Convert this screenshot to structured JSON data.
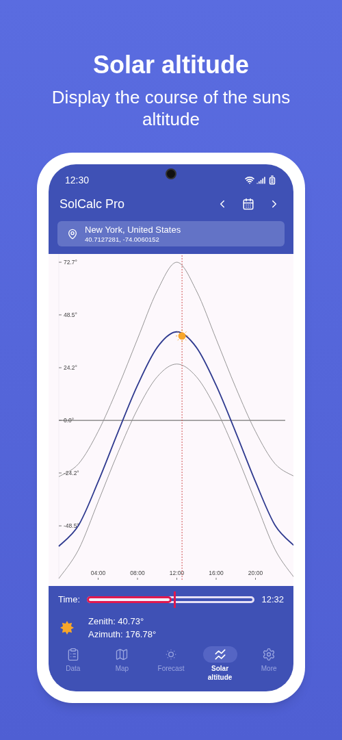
{
  "header": {
    "title": "Solar altitude",
    "subtitle": "Display the course of the suns altitude"
  },
  "status_bar": {
    "time": "12:30"
  },
  "app_bar": {
    "title": "SolCalc Pro"
  },
  "location": {
    "name": "New York, United States",
    "coordinates": "40.7127281, -74.0060152"
  },
  "chart": {
    "chart_data": {
      "type": "line",
      "x": [
        0,
        2,
        4,
        6,
        8,
        10,
        12,
        14,
        16,
        18,
        20,
        22,
        24
      ],
      "xlim": [
        0,
        24
      ],
      "ylim": [
        -73,
        76.5
      ],
      "xticks": [
        {
          "value": 4,
          "label": "04:00"
        },
        {
          "value": 8,
          "label": "08:00"
        },
        {
          "value": 12,
          "label": "12:00"
        },
        {
          "value": 16,
          "label": "16:00"
        },
        {
          "value": 20,
          "label": "20:00"
        }
      ],
      "yticks": [
        {
          "value": 72.7,
          "label": "72.7°"
        },
        {
          "value": 48.5,
          "label": "48.5°"
        },
        {
          "value": 24.2,
          "label": "24.2°"
        },
        {
          "value": 0,
          "label": "0.0°"
        },
        {
          "value": -24.2,
          "label": "-24.2°"
        },
        {
          "value": -48.5,
          "label": "-48.5°"
        }
      ],
      "series": [
        {
          "color": "#8a8a8a",
          "values": [
            -25.9,
            -20.0,
            -5.1,
            15.0,
            37.4,
            59.5,
            72.7,
            59.5,
            37.4,
            15.0,
            -5.1,
            -20.0,
            -25.9
          ]
        },
        {
          "color": "#8a8a8a",
          "values": [
            -72.7,
            -59.5,
            -37.4,
            -15.0,
            5.1,
            20.0,
            25.9,
            20.0,
            5.1,
            -15.0,
            -37.4,
            -59.5,
            -72.7
          ]
        },
        {
          "color": "#2f3a8f",
          "values": [
            -57.9,
            -48.3,
            -28.2,
            -5.6,
            16.1,
            33.5,
            40.7,
            33.5,
            16.1,
            -5.6,
            -28.2,
            -48.3,
            -57.9
          ]
        }
      ],
      "ref_lines": [
        {
          "axis": "x",
          "value": 12.53
        }
      ]
    }
  },
  "time_slider": {
    "label": "Time:",
    "level": 0.522,
    "value": "12:32"
  },
  "sun_info": {
    "zenith": "Zenith: 40.73°",
    "azimuth": "Azimuth: 176.78°"
  },
  "nav": [
    {
      "label": "Data",
      "selected": false
    },
    {
      "label": "Map",
      "selected": false
    },
    {
      "label": "Forecast",
      "selected": false
    },
    {
      "label": "Solar altitude",
      "selected": true
    },
    {
      "label": "More",
      "selected": false
    }
  ]
}
